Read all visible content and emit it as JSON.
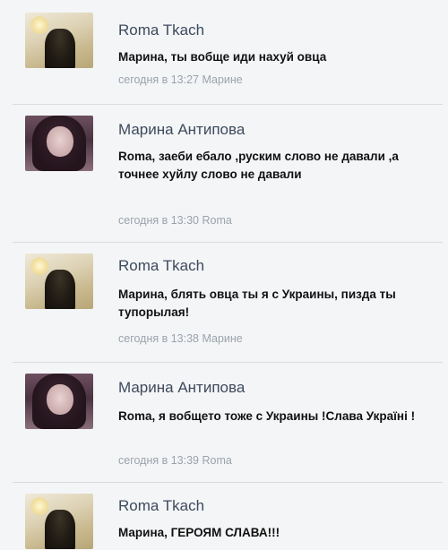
{
  "comments": [
    {
      "author": "Roma Tkach",
      "avatar": "roma",
      "text": "Марина, ты вобще иди нахуй овца",
      "meta": "сегодня в 13:27 Марине"
    },
    {
      "author": "Марина Антипова",
      "avatar": "marina",
      "text": "Roma, заеби ебало ,руским слово не давали ,а точнее хуйлу слово не давали",
      "meta": "сегодня в 13:30 Roma"
    },
    {
      "author": "Roma Tkach",
      "avatar": "roma",
      "text": "Марина, блять овца ты я с Украины, пизда ты тупорылая!",
      "meta": "сегодня в 13:38 Марине"
    },
    {
      "author": "Марина Антипова",
      "avatar": "marina",
      "text": "Roma, я вобщето тоже с Украины !Слава Україні !",
      "meta": "сегодня в 13:39 Roma"
    },
    {
      "author": "Roma Tkach",
      "avatar": "roma",
      "text": "Марина, ГЕРОЯМ СЛАВА!!!",
      "meta": ""
    }
  ]
}
